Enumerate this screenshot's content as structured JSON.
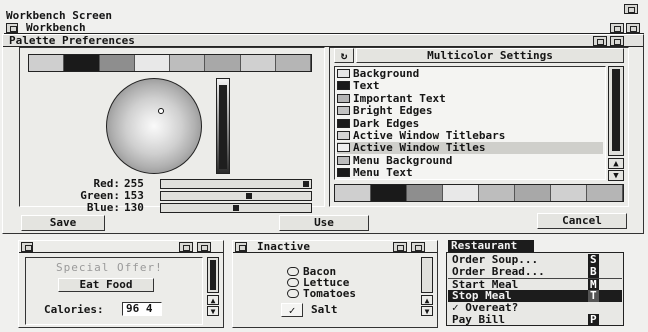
{
  "screen": {
    "title": "Workbench Screen"
  },
  "workbench_window": {
    "title": "Workbench"
  },
  "palette_prefs": {
    "title": "Palette Preferences",
    "palette_colors": [
      "#cfcfcf",
      "#1a1a1a",
      "#8e8e8e",
      "#e8e8e8",
      "#bdbdbd",
      "#a8a8a8",
      "#d0d0d0",
      "#b5b5b5"
    ],
    "sliders": [
      {
        "label": "Red:",
        "value": "255",
        "level": 1.0
      },
      {
        "label": "Green:",
        "value": "153",
        "level": 0.6
      },
      {
        "label": "Blue:",
        "value": "130",
        "level": 0.51
      }
    ],
    "cycle_symbol": "↻",
    "list_title": "Multicolor Settings",
    "list_items": [
      {
        "label": "Background",
        "color": "#e6e6e6"
      },
      {
        "label": "Text",
        "color": "#1a1a1a"
      },
      {
        "label": "Important Text",
        "color": "#b5b5b5"
      },
      {
        "label": "Bright Edges",
        "color": "#c2c2c2"
      },
      {
        "label": "Dark Edges",
        "color": "#1a1a1a"
      },
      {
        "label": "Active Window Titlebars",
        "color": "#d4d4d4"
      },
      {
        "label": "Active Window Titles",
        "color": "#efefef",
        "selected": true
      },
      {
        "label": "Menu Background",
        "color": "#bcbcbc"
      },
      {
        "label": "Menu Text",
        "color": "#1a1a1a"
      }
    ],
    "save_label": "Save",
    "use_label": "Use",
    "cancel_label": "Cancel"
  },
  "left_window": {
    "special_offer": "Special Offer!",
    "eat_button": "Eat Food",
    "calories_label": "Calories:",
    "calories_value": "96 4"
  },
  "inactive_window": {
    "title": "Inactive",
    "options": [
      "Bacon",
      "Lettuce",
      "Tomatoes"
    ],
    "salt_check": "✓",
    "salt_label": "Salt"
  },
  "restaurant_menu": {
    "title": "Restaurant",
    "items": [
      {
        "label": "Order Soup...",
        "shortcut": "S"
      },
      {
        "label": "Order Bread...",
        "shortcut": "B"
      },
      {
        "label": "Start Meal",
        "shortcut": "M"
      },
      {
        "label": "Stop Meal",
        "shortcut": "T",
        "highlight": true
      },
      {
        "label": "✓ Overeat?",
        "shortcut": ""
      },
      {
        "label": "Pay Bill",
        "shortcut": "P"
      }
    ]
  }
}
